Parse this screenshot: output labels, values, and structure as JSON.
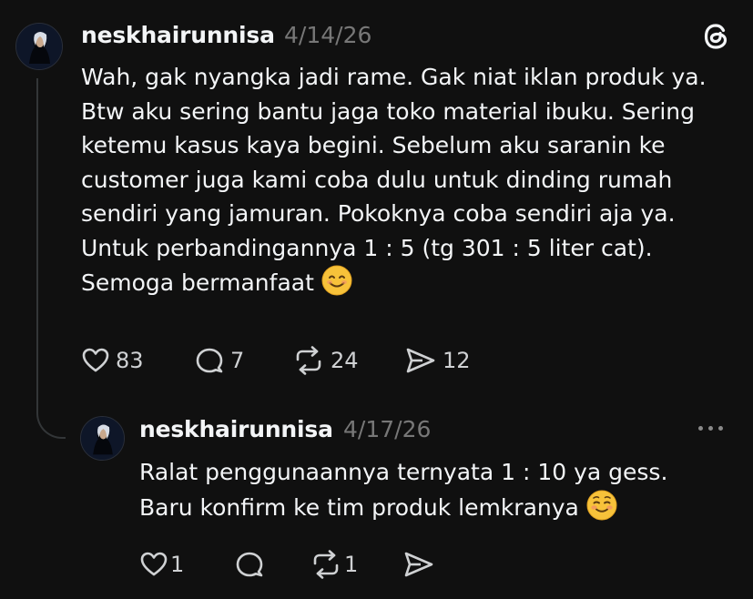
{
  "app": {
    "logo_icon": "threads-logo-icon"
  },
  "post": {
    "username": "neskhairunnisa",
    "date": "4/14/26",
    "text": "Wah, gak nyangka jadi rame. Gak niat iklan produk ya. Btw aku sering bantu jaga toko material ibuku. Sering ketemu kasus kaya begini. Sebelum aku saranin ke customer juga kami coba dulu untuk dinding rumah sendiri yang jamuran. Pokoknya coba sendiri aja ya. Untuk perbandingannya 1 : 5 (tg 301 : 5 liter cat). Semoga bermanfaat",
    "emoji": "smiling-face-emoji",
    "likes": "83",
    "replies": "7",
    "reposts": "24",
    "shares": "12"
  },
  "reply": {
    "username": "neskhairunnisa",
    "date": "4/17/26",
    "text_line1": "Ralat penggunaannya ternyata 1 : 10 ya gess.",
    "text_line2": "Baru konfirm ke tim produk lemkranya",
    "emoji": "relieved-smiling-face-emoji",
    "likes": "1",
    "replies": "",
    "reposts": "1",
    "shares": ""
  },
  "colors": {
    "background": "#101010",
    "text": "#f3f5f7",
    "muted": "#777777",
    "thread_line": "#333638"
  }
}
